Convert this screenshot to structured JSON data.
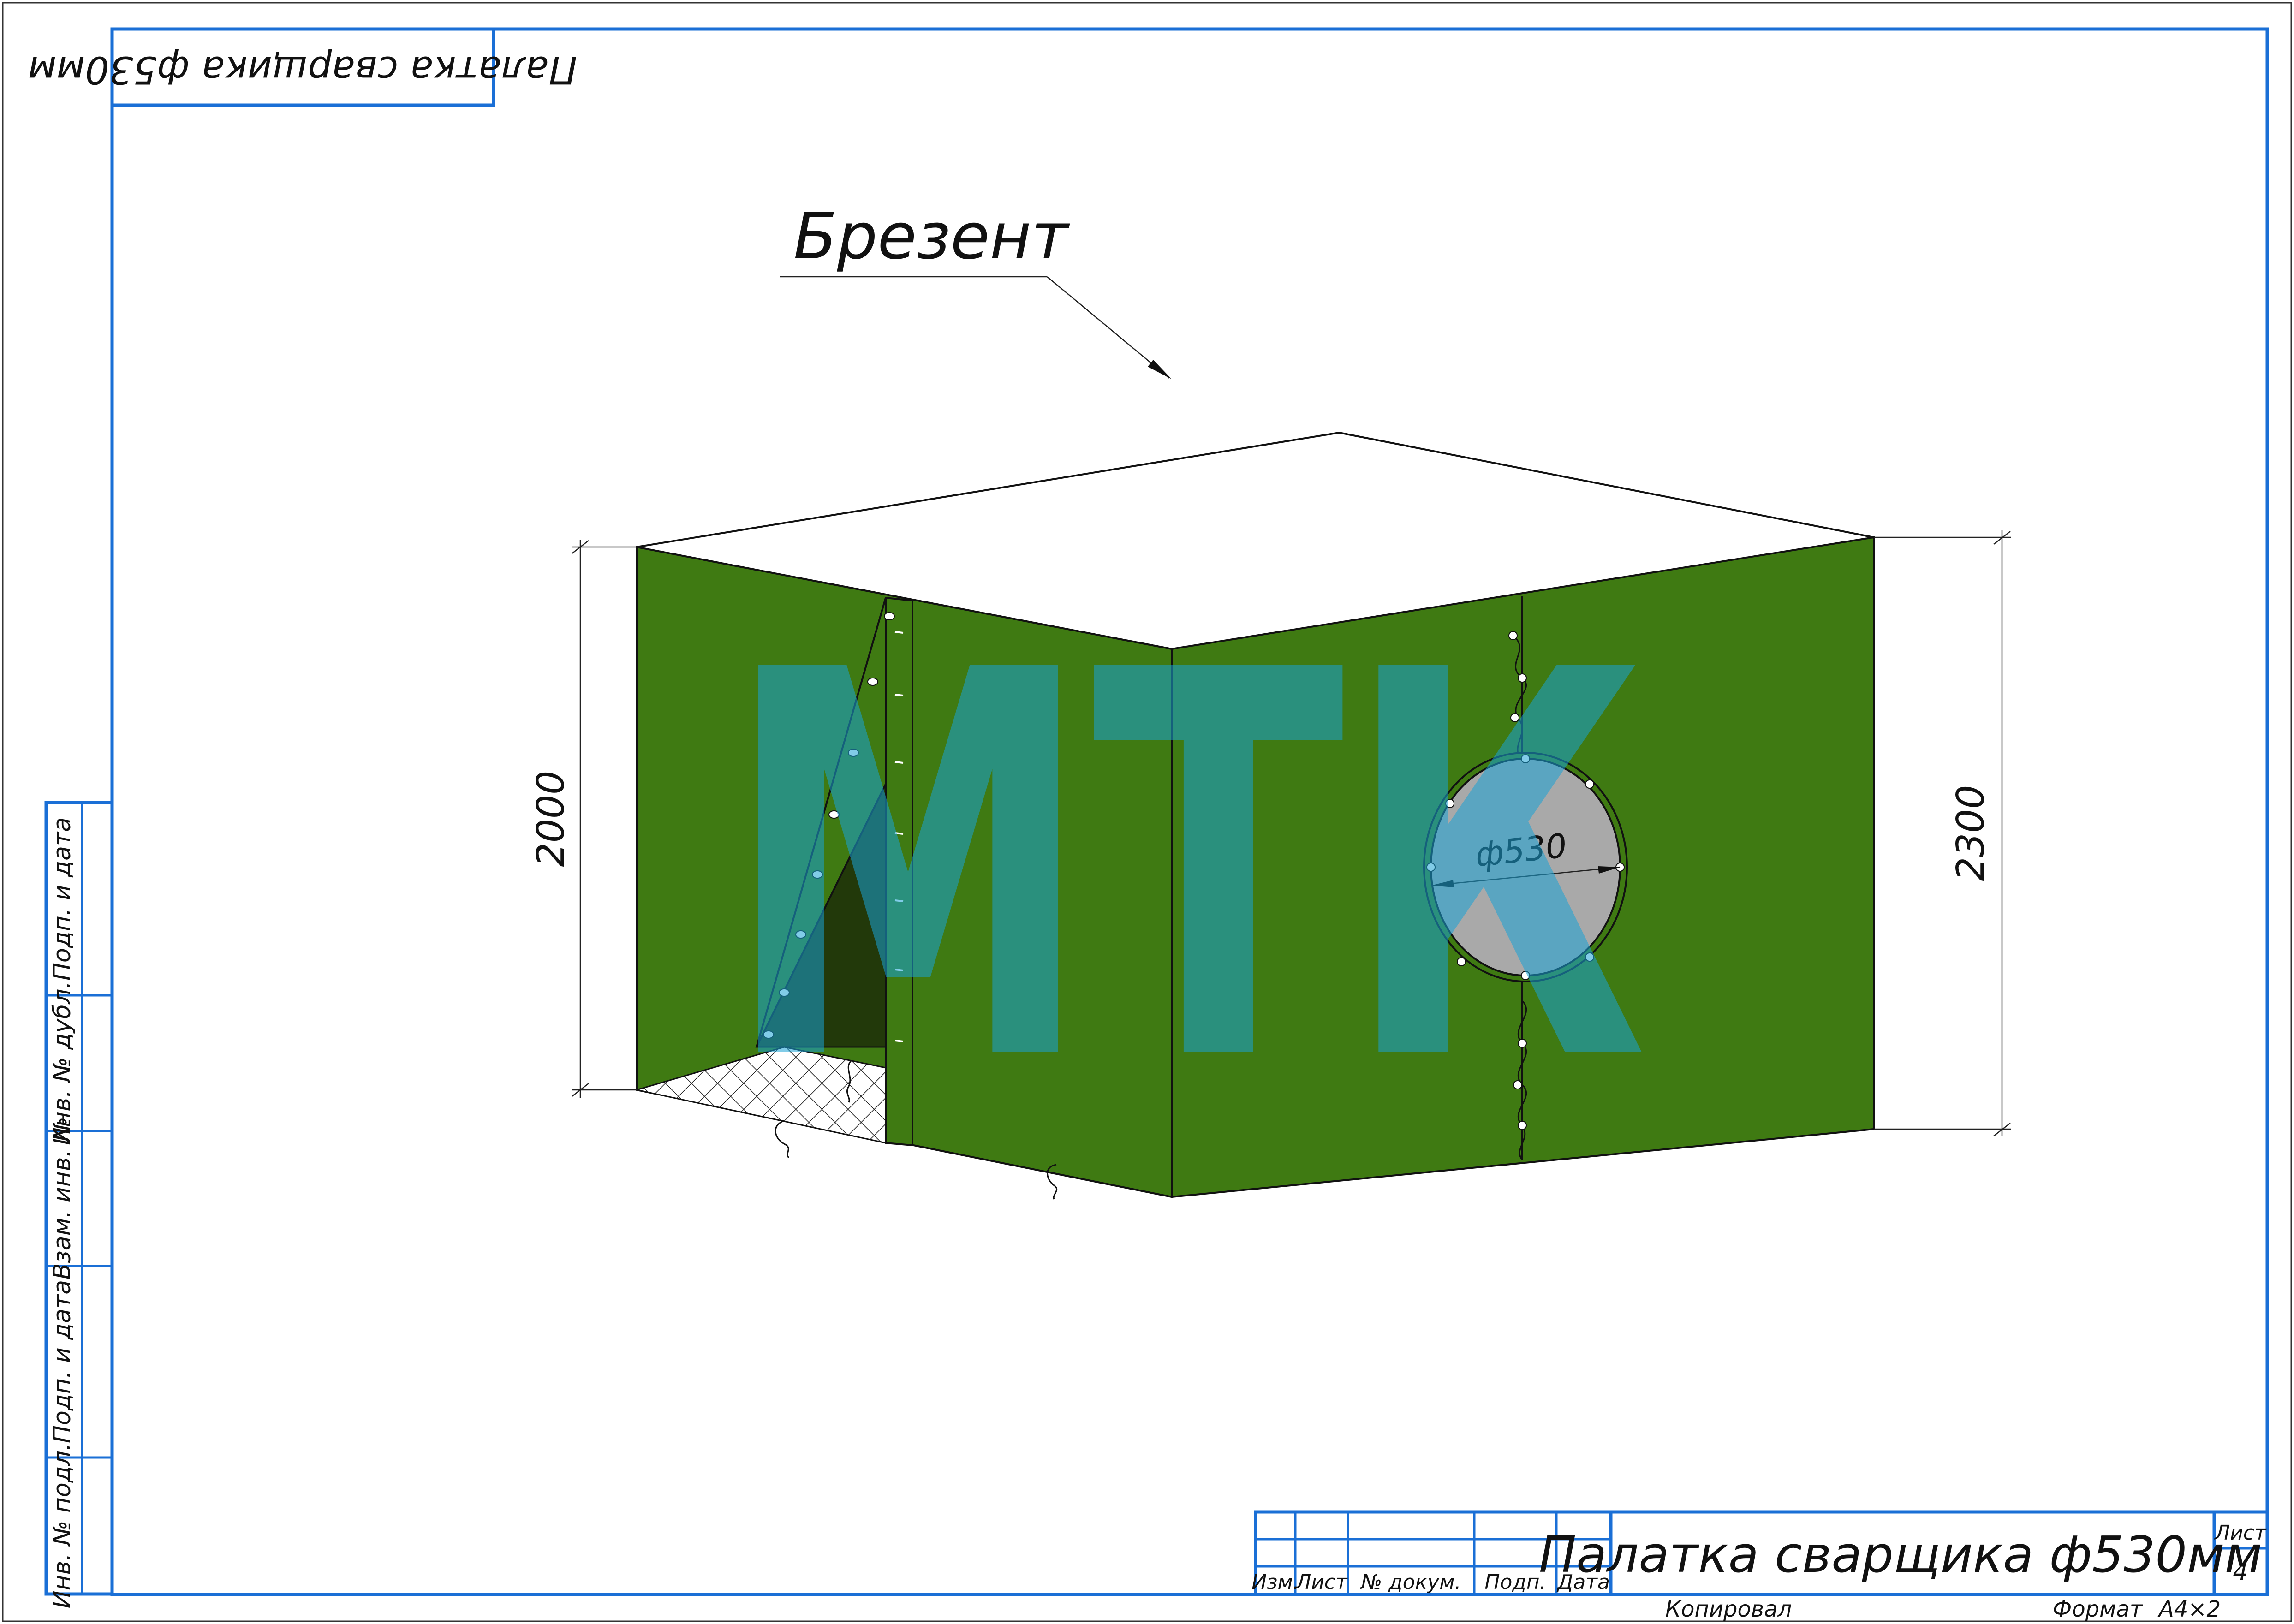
{
  "drawing": {
    "top_stamp": "Палатка сварщика ф530мм",
    "callout_label": "Брезент",
    "dim_left_height": "2000",
    "dim_right_height": "2300",
    "dim_porthole_diameter": "ф530",
    "watermark": "МТК"
  },
  "side_stamp": {
    "cells": [
      "Инв. № подл.",
      "Подп. и дата",
      "Взам. инв. №",
      "Инв. № дубл.",
      "Подп. и дата"
    ]
  },
  "title_block": {
    "headers": [
      "Изм.",
      "Лист",
      "№ докум.",
      "Подп.",
      "Дата"
    ],
    "title": "Палатка сварщика ф530мм",
    "sheet_label": "Лист",
    "sheet_number": "4",
    "copied": "Копировал",
    "format_label": "Формат",
    "format_value": "А4×2"
  },
  "colors": {
    "frame": "#1a6fd6",
    "canvas_green": "#3f7a12",
    "canvas_green_dark": "#2e5c0c",
    "porthole_fill": "#a9a9a9",
    "watermark": "#19a3d6"
  }
}
